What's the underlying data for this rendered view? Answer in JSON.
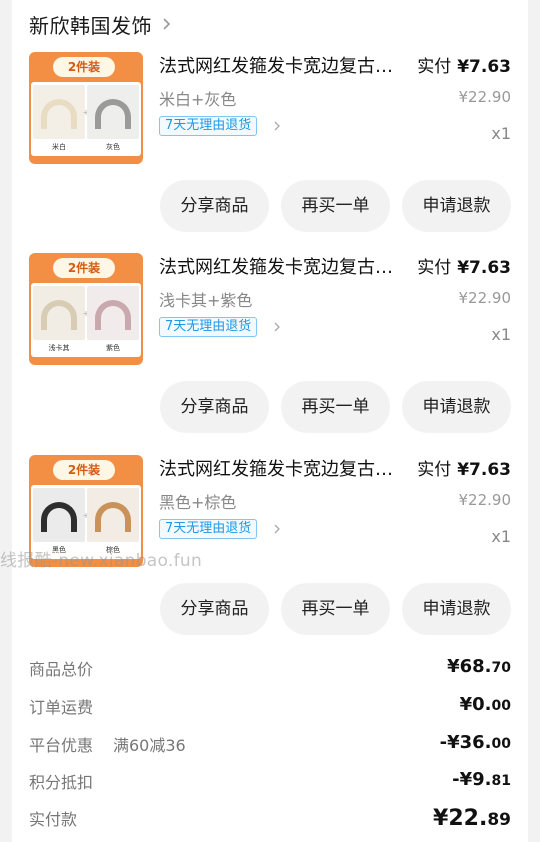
{
  "shop": {
    "name": "新欣韩国发饰"
  },
  "items": [
    {
      "title": "法式网红发箍发卡宽边复古百搭头箍",
      "variant": "米白+灰色",
      "actual_label": "实付",
      "actual_price": "¥7.63",
      "orig_price": "¥22.90",
      "refund_badge": "7天无理由退货",
      "qty": "x1",
      "thumb": {
        "banner": "2件装",
        "left_caption": "米白",
        "right_caption": "灰色",
        "left_color": "#e8dcc3",
        "right_color": "#9a9a98"
      }
    },
    {
      "title": "法式网红发箍发卡宽边复古百搭头箍",
      "variant": "浅卡其+紫色",
      "actual_label": "实付",
      "actual_price": "¥7.63",
      "orig_price": "¥22.90",
      "refund_badge": "7天无理由退货",
      "qty": "x1",
      "thumb": {
        "banner": "2件装",
        "left_caption": "浅卡其",
        "right_caption": "紫色",
        "left_color": "#d8ccb4",
        "right_color": "#c9a9ae"
      }
    },
    {
      "title": "法式网红发箍发卡宽边复古百搭头箍",
      "variant": "黑色+棕色",
      "actual_label": "实付",
      "actual_price": "¥7.63",
      "orig_price": "¥22.90",
      "refund_badge": "7天无理由退货",
      "qty": "x1",
      "thumb": {
        "banner": "2件装",
        "left_caption": "黑色",
        "right_caption": "棕色",
        "left_color": "#2e2e2e",
        "right_color": "#c9925a"
      }
    }
  ],
  "buttons": {
    "share": "分享商品",
    "rebuy": "再买一单",
    "refund": "申请退款"
  },
  "watermark": "线报酷-new.xianbao.fun",
  "summary": {
    "goods_total": {
      "label": "商品总价",
      "int": "¥68.",
      "dec": "70"
    },
    "shipping": {
      "label": "订单运费",
      "int": "¥0.",
      "dec": "00"
    },
    "platform": {
      "label": "平台优惠",
      "promo": "满60减36",
      "int": "-¥36.",
      "dec": "00"
    },
    "points": {
      "label": "积分抵扣",
      "int": "-¥9.",
      "dec": "81"
    },
    "paid": {
      "label": "实付款",
      "int": "¥22.",
      "dec": "89"
    }
  },
  "colors": {
    "accent_blue": "#1e98e6",
    "thumb_orange": "#f28f45",
    "button_bg": "#f2f2f2"
  },
  "icons": {
    "shop_chevron": "chevron-right-icon",
    "refund_chevron": "chevron-right-icon"
  }
}
